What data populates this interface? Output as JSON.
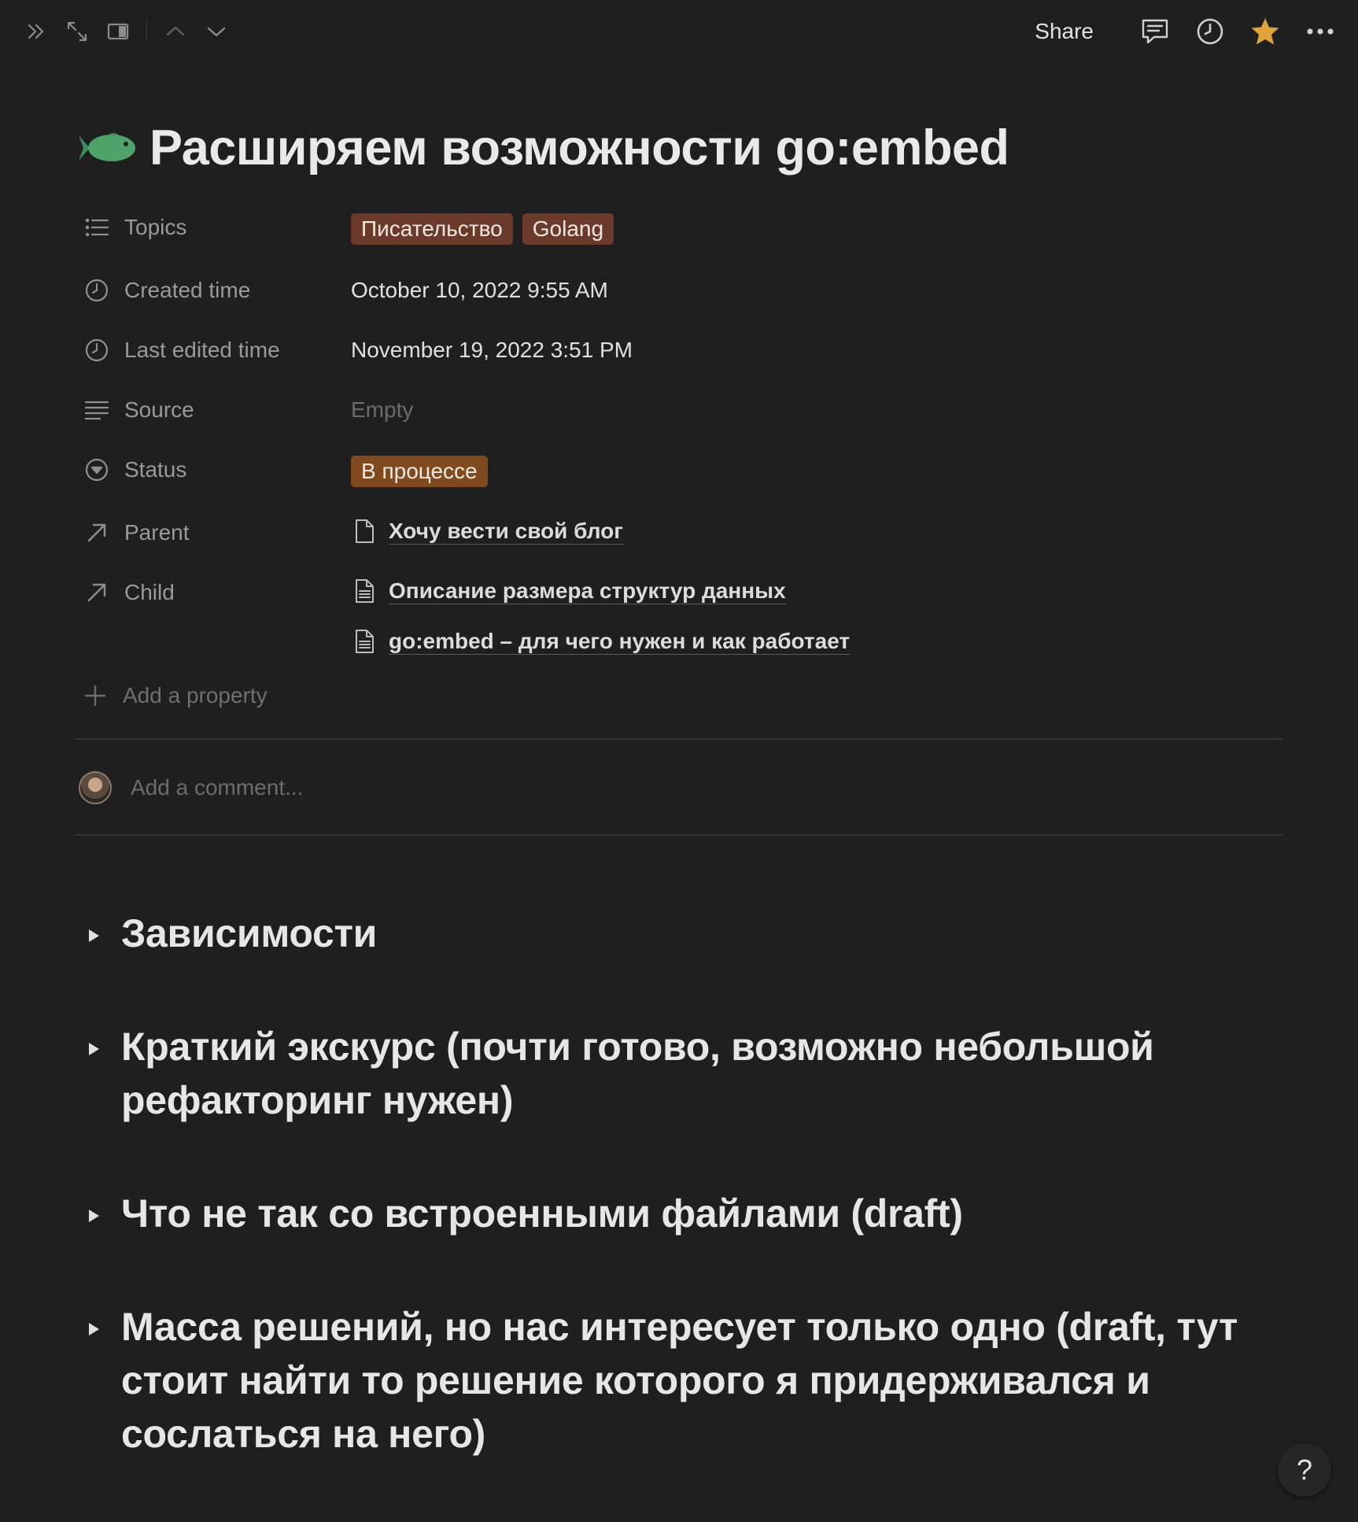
{
  "topbar": {
    "share_label": "Share",
    "icons": [
      "double-chevron-right-icon",
      "expand-icon",
      "sidebar-toggle-icon",
      "chevron-up-icon",
      "chevron-down-icon",
      "comment-icon",
      "clock-icon",
      "star-icon",
      "more-icon"
    ],
    "star_color": "#e0a43a"
  },
  "page": {
    "icon": "fish-icon",
    "icon_color": "#4fa36a",
    "title": "Расширяем возможности go:embed"
  },
  "properties": {
    "topics": {
      "label": "Topics",
      "tags": [
        {
          "text": "Писательство",
          "color": "#6b3a2a"
        },
        {
          "text": "Golang",
          "color": "#6b3a2a"
        }
      ]
    },
    "created_time": {
      "label": "Created time",
      "value": "October 10, 2022 9:55 AM"
    },
    "last_edited_time": {
      "label": "Last edited time",
      "value": "November 19, 2022 3:51 PM"
    },
    "source": {
      "label": "Source",
      "value": "Empty"
    },
    "status": {
      "label": "Status",
      "value": "В процессе",
      "color": "#7e4a1e"
    },
    "parent": {
      "label": "Parent",
      "value": "Хочу вести свой блог"
    },
    "child": {
      "label": "Child",
      "values": [
        "Описание размера структур данных",
        "go:embed – для чего нужен и как работает"
      ]
    },
    "add_property_label": "Add a property"
  },
  "comment": {
    "placeholder": "Add a comment..."
  },
  "toggles": [
    {
      "text": "Зависимости"
    },
    {
      "text": "Краткий экскурс (почти готово, возможно небольшой рефакторинг нужен)"
    },
    {
      "text": "Что не так со встроенными файлами (draft)"
    },
    {
      "text": "Масса решений, но нас интересует только одно (draft, тут стоит найти то решение которого я придерживался и сослаться на него)"
    }
  ],
  "help": {
    "label": "?"
  }
}
